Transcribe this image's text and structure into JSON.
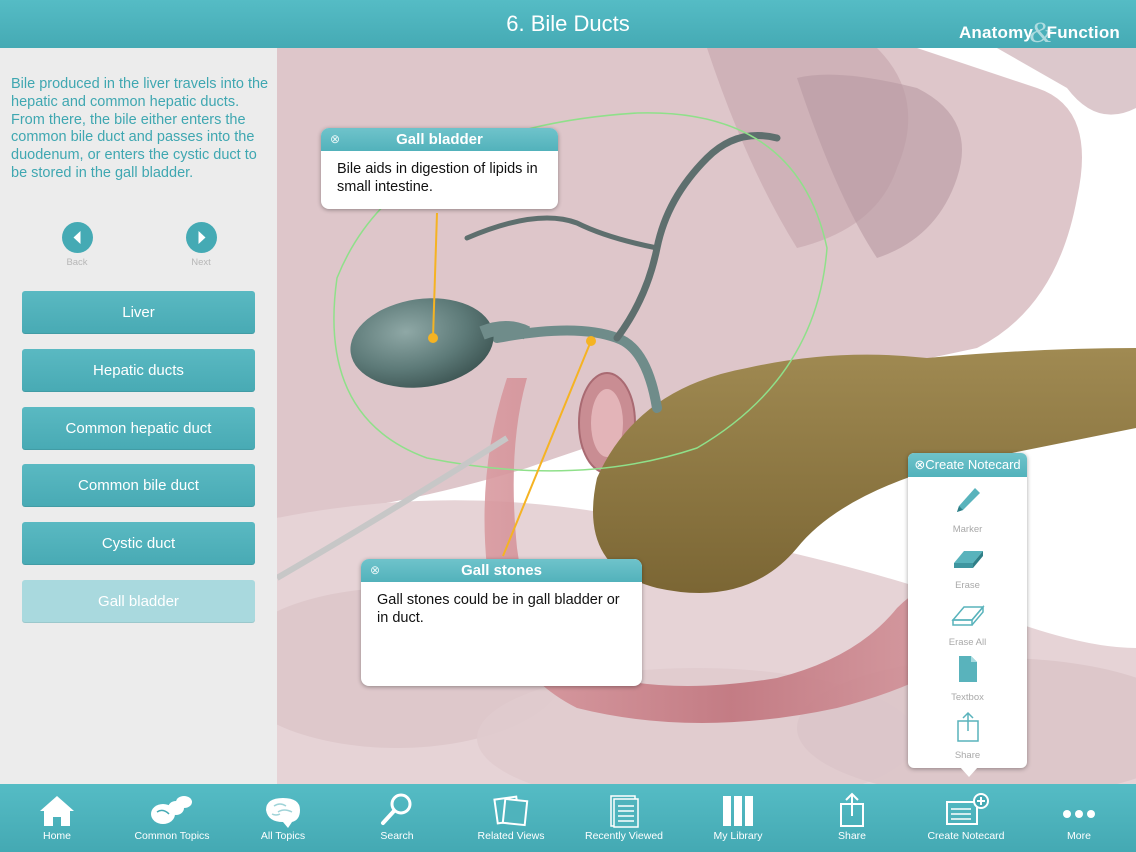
{
  "header": {
    "title": "6. Bile Ducts",
    "brand_left": "Anatomy",
    "brand_amp": "&",
    "brand_right": "Function"
  },
  "sidebar": {
    "description": "Bile produced in the liver travels into the hepatic and common hepatic ducts. From there, the bile either enters the common bile duct and passes into the duodenum, or enters the cystic duct to be stored in the gall bladder.",
    "back_label": "Back",
    "next_label": "Next",
    "topics": [
      {
        "label": "Liver",
        "active": false
      },
      {
        "label": "Hepatic ducts",
        "active": false
      },
      {
        "label": "Common hepatic duct",
        "active": false
      },
      {
        "label": "Common bile duct",
        "active": false
      },
      {
        "label": "Cystic duct",
        "active": false
      },
      {
        "label": "Gall bladder",
        "active": true
      }
    ]
  },
  "callouts": {
    "gall_bladder": {
      "title": "Gall bladder",
      "body": "Bile aids in digestion of lipids in small intestine."
    },
    "gall_stones": {
      "title": "Gall stones",
      "body": "Gall stones could be in gall bladder or in duct."
    }
  },
  "notecard": {
    "title": "Create Notecard",
    "tools": [
      {
        "label": "Marker",
        "icon": "marker-icon"
      },
      {
        "label": "Erase",
        "icon": "erase-icon"
      },
      {
        "label": "Erase All",
        "icon": "erase-all-icon"
      },
      {
        "label": "Textbox",
        "icon": "textbox-icon"
      },
      {
        "label": "Share",
        "icon": "share-icon"
      }
    ]
  },
  "tabbar": {
    "tabs": [
      {
        "label": "Home",
        "icon": "home-icon"
      },
      {
        "label": "Common Topics",
        "icon": "common-topics-icon"
      },
      {
        "label": "All Topics",
        "icon": "brain-icon"
      },
      {
        "label": "Search",
        "icon": "search-icon"
      },
      {
        "label": "Related Views",
        "icon": "related-views-icon"
      },
      {
        "label": "Recently Viewed",
        "icon": "recently-viewed-icon"
      },
      {
        "label": "My Library",
        "icon": "library-icon"
      },
      {
        "label": "Share",
        "icon": "share-icon"
      },
      {
        "label": "Create Notecard",
        "icon": "create-notecard-icon"
      },
      {
        "label": "More",
        "icon": "more-icon"
      }
    ]
  },
  "colors": {
    "accent": "#45aab4",
    "sidebar_bg": "#ececec",
    "text_accent": "#3fa7b1",
    "highlight_line": "#f5b323",
    "selection_outline": "#8fe08a"
  }
}
